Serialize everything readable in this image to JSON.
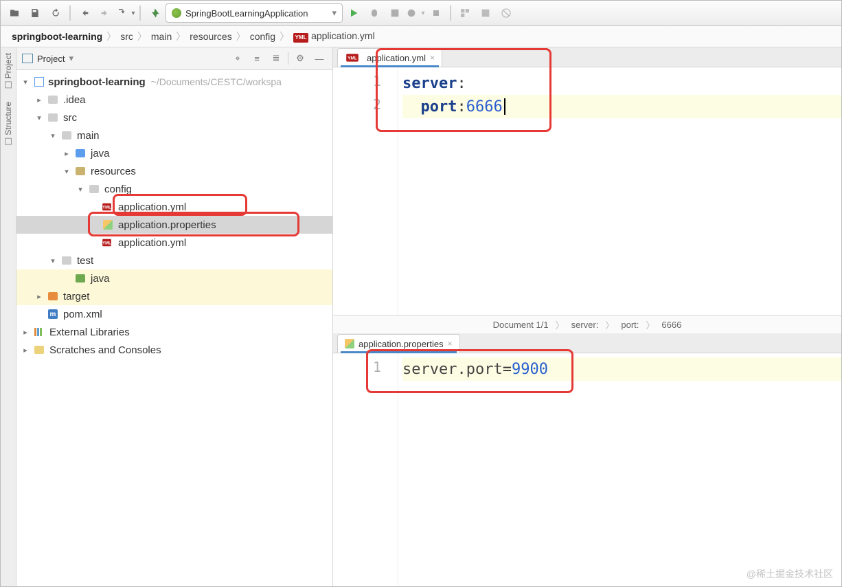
{
  "toolbar": {
    "run_config": "SpringBootLearningApplication"
  },
  "breadcrumbs": [
    "springboot-learning",
    "src",
    "main",
    "resources",
    "config",
    "application.yml"
  ],
  "project": {
    "title": "Project",
    "root": {
      "name": "springboot-learning",
      "path": "~/Documents/CESTC/workspa"
    },
    "nodes": {
      "idea": ".idea",
      "src": "src",
      "main": "main",
      "java": "java",
      "resources": "resources",
      "config": "config",
      "app_yml_cfg": "application.yml",
      "app_props": "application.properties",
      "app_yml_res": "application.yml",
      "test": "test",
      "java_test": "java",
      "target": "target",
      "pom": "pom.xml",
      "ext": "External Libraries",
      "scratch": "Scratches and Consoles"
    }
  },
  "leftbar": {
    "project": "Project",
    "structure": "Structure"
  },
  "editors": {
    "top": {
      "tab": "application.yml",
      "lines": [
        {
          "n": "1",
          "k": "server",
          "c": ":"
        },
        {
          "n": "2",
          "indent": "  ",
          "k": "port",
          "c": ": ",
          "v": "6666"
        }
      ]
    },
    "bottom": {
      "tab": "application.properties",
      "lines": [
        {
          "n": "1",
          "k": "server.port",
          "eq": "=",
          "v": "9900"
        }
      ]
    }
  },
  "status": {
    "doc": "Document 1/1",
    "p1": "server:",
    "p2": "port:",
    "val": "6666"
  },
  "watermark": "@稀土掘金技术社区"
}
